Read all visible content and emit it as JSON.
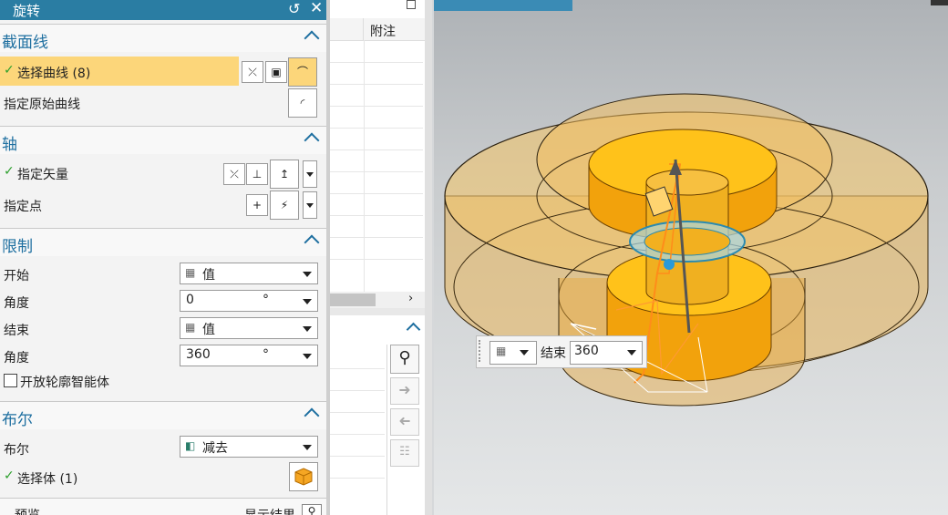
{
  "dialog": {
    "title": "旋转",
    "sections": {
      "section_curve": {
        "title": "截面线"
      },
      "axis": {
        "title": "轴"
      },
      "limits": {
        "title": "限制"
      },
      "boolean": {
        "title": "布尔"
      }
    },
    "select_curve": {
      "label": "选择曲线 (8)"
    },
    "specify_original_curve": {
      "label": "指定原始曲线"
    },
    "specify_vector": {
      "label": "指定矢量"
    },
    "specify_point": {
      "label": "指定点"
    },
    "start": {
      "label": "开始",
      "value": "值"
    },
    "start_angle": {
      "label": "角度",
      "value": "0",
      "unit": "°"
    },
    "end": {
      "label": "结束",
      "value": "值"
    },
    "end_angle": {
      "label": "角度",
      "value": "360",
      "unit": "°"
    },
    "open_profile": {
      "label": "开放轮廓智能体"
    },
    "boolean_field": {
      "label": "布尔",
      "value": "减去"
    },
    "select_body": {
      "label": "选择体 (1)"
    },
    "preview": {
      "label": "预览",
      "show_result": "显示结果"
    }
  },
  "middle_panel": {
    "column_header": "附注"
  },
  "viewport": {
    "onscreen_input": {
      "label": "结束",
      "value": "360"
    }
  },
  "colors": {
    "title_bar": "#2a7da3",
    "section_title": "#1e6fa0",
    "selection_highlight": "#fcd67a",
    "model_orange": "#f2a20c",
    "model_transparent": "#e6b55a"
  }
}
